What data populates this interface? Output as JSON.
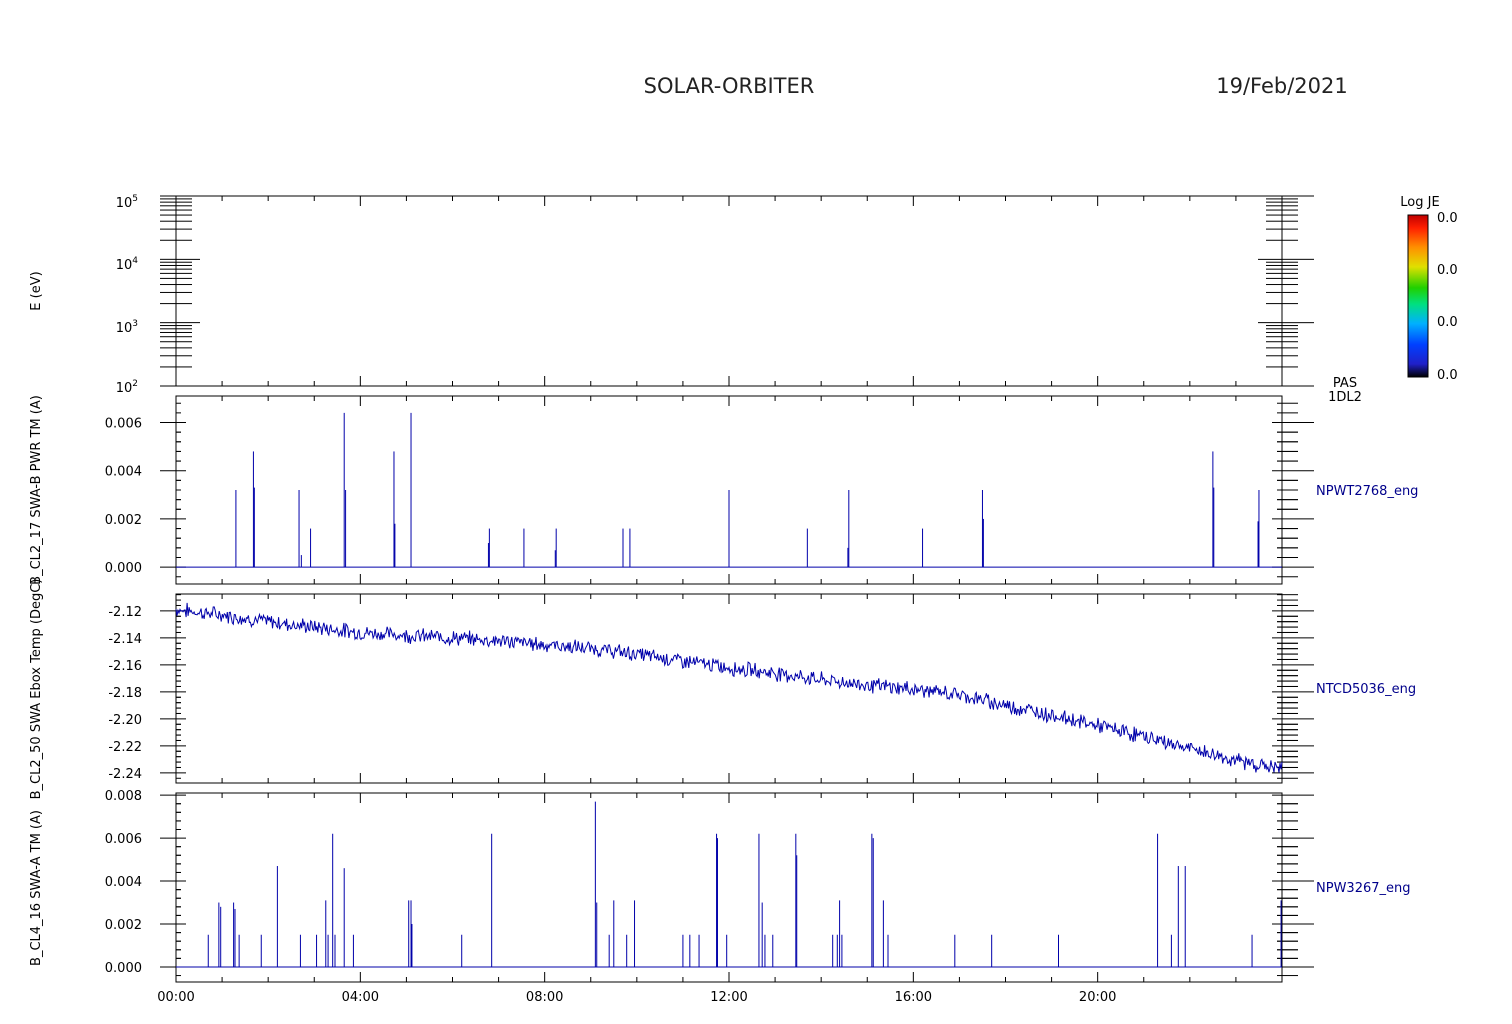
{
  "header": {
    "title": "SOLAR-ORBITER",
    "date": "19/Feb/2021"
  },
  "colorbar": {
    "title": "Log JE",
    "ticks": [
      "0.0",
      "0.0",
      "0.0",
      "0.0"
    ]
  },
  "colors": {
    "axes": "#000000",
    "series": "#0000aa",
    "series_label": "#00008b"
  },
  "chart_data": [
    {
      "type": "heatmap",
      "ylabel": "E (eV)",
      "yscale": "log",
      "ylim": [
        100,
        100000
      ],
      "yticks": [
        {
          "base": "10",
          "exp": "2",
          "value": 100
        },
        {
          "base": "10",
          "exp": "3",
          "value": 1000
        },
        {
          "base": "10",
          "exp": "4",
          "value": 10000
        },
        {
          "base": "10",
          "exp": "5",
          "value": 100000
        }
      ],
      "side_label": [
        "PAS",
        "1DL2"
      ]
    },
    {
      "type": "line",
      "ylabel": "B_CL2_17 SWA-B PWR TM (A)",
      "ylim": [
        -0.0007,
        0.0071
      ],
      "yticks": [
        "0.000",
        "0.002",
        "0.004",
        "0.006"
      ],
      "series_name": "NPWT2768_eng",
      "spikes": [
        [
          1.3,
          0.0032
        ],
        [
          1.68,
          0.0048
        ],
        [
          1.7,
          0.0033
        ],
        [
          2.67,
          0.0032
        ],
        [
          2.72,
          0.0005
        ],
        [
          2.92,
          0.0016
        ],
        [
          3.65,
          0.0064
        ],
        [
          3.68,
          0.0032
        ],
        [
          4.73,
          0.0048
        ],
        [
          4.75,
          0.0018
        ],
        [
          5.1,
          0.0064
        ],
        [
          6.8,
          0.0016
        ],
        [
          6.78,
          0.001
        ],
        [
          7.55,
          0.0016
        ],
        [
          8.25,
          0.0016
        ],
        [
          8.23,
          0.0007
        ],
        [
          9.7,
          0.0016
        ],
        [
          9.85,
          0.0016
        ],
        [
          12.0,
          0.0032
        ],
        [
          13.7,
          0.0016
        ],
        [
          14.6,
          0.0032
        ],
        [
          14.58,
          0.0008
        ],
        [
          16.2,
          0.0016
        ],
        [
          17.5,
          0.0032
        ],
        [
          17.52,
          0.002
        ],
        [
          22.5,
          0.0048
        ],
        [
          22.52,
          0.0033
        ],
        [
          23.5,
          0.0032
        ],
        [
          23.48,
          0.0019
        ]
      ]
    },
    {
      "type": "line",
      "ylabel": "B_CL2_50 SWA Ebox Temp (DegC)",
      "ylim": [
        -2.2475,
        -2.1075
      ],
      "yticks": [
        "-2.12",
        "-2.14",
        "-2.16",
        "-2.18",
        "-2.20",
        "-2.22",
        "-2.24"
      ],
      "series_name": "NTCD5036_eng",
      "trend": [
        [
          0,
          -2.119
        ],
        [
          1,
          -2.123
        ],
        [
          2,
          -2.128
        ],
        [
          3,
          -2.132
        ],
        [
          4,
          -2.136
        ],
        [
          5,
          -2.138
        ],
        [
          6,
          -2.14
        ],
        [
          7,
          -2.142
        ],
        [
          8,
          -2.145
        ],
        [
          9,
          -2.148
        ],
        [
          10,
          -2.152
        ],
        [
          11,
          -2.157
        ],
        [
          12,
          -2.162
        ],
        [
          13,
          -2.166
        ],
        [
          14,
          -2.171
        ],
        [
          15,
          -2.175
        ],
        [
          16,
          -2.178
        ],
        [
          17,
          -2.182
        ],
        [
          18,
          -2.19
        ],
        [
          19,
          -2.197
        ],
        [
          20,
          -2.205
        ],
        [
          21,
          -2.213
        ],
        [
          22,
          -2.222
        ],
        [
          23,
          -2.231
        ],
        [
          24,
          -2.237
        ]
      ]
    },
    {
      "type": "line",
      "ylabel": "B_CL4_16 SWA-A TM (A)",
      "ylim": [
        -0.0007,
        0.0081
      ],
      "yticks": [
        "0.000",
        "0.002",
        "0.004",
        "0.006",
        "0.008"
      ],
      "series_name": "NPW3267_eng",
      "xlabels": [
        "00:00",
        "04:00",
        "08:00",
        "12:00",
        "16:00",
        "20:00"
      ],
      "xlim": [
        0,
        24
      ],
      "spikes": [
        [
          0.7,
          0.0015
        ],
        [
          0.93,
          0.003
        ],
        [
          0.97,
          0.0028
        ],
        [
          1.25,
          0.003
        ],
        [
          1.28,
          0.0027
        ],
        [
          1.37,
          0.0015
        ],
        [
          1.85,
          0.0015
        ],
        [
          2.2,
          0.0047
        ],
        [
          2.7,
          0.0015
        ],
        [
          3.05,
          0.0015
        ],
        [
          3.25,
          0.0031
        ],
        [
          3.3,
          0.0015
        ],
        [
          3.4,
          0.0062
        ],
        [
          3.45,
          0.0015
        ],
        [
          3.65,
          0.0046
        ],
        [
          3.85,
          0.0015
        ],
        [
          5.05,
          0.0031
        ],
        [
          5.1,
          0.0031
        ],
        [
          5.12,
          0.002
        ],
        [
          6.2,
          0.0015
        ],
        [
          6.85,
          0.0062
        ],
        [
          9.1,
          0.0077
        ],
        [
          9.13,
          0.003
        ],
        [
          9.4,
          0.0015
        ],
        [
          9.5,
          0.0031
        ],
        [
          9.78,
          0.0015
        ],
        [
          9.95,
          0.0031
        ],
        [
          11.0,
          0.0015
        ],
        [
          11.15,
          0.0015
        ],
        [
          11.35,
          0.0015
        ],
        [
          11.73,
          0.0062
        ],
        [
          11.75,
          0.006
        ],
        [
          11.95,
          0.0015
        ],
        [
          12.65,
          0.0062
        ],
        [
          12.72,
          0.003
        ],
        [
          12.78,
          0.0015
        ],
        [
          12.95,
          0.0015
        ],
        [
          13.45,
          0.0062
        ],
        [
          13.47,
          0.0052
        ],
        [
          14.25,
          0.0015
        ],
        [
          14.35,
          0.0015
        ],
        [
          14.4,
          0.0031
        ],
        [
          14.45,
          0.0015
        ],
        [
          15.1,
          0.0062
        ],
        [
          15.13,
          0.006
        ],
        [
          15.35,
          0.0031
        ],
        [
          15.45,
          0.0015
        ],
        [
          16.9,
          0.0015
        ],
        [
          17.7,
          0.0015
        ],
        [
          19.15,
          0.0015
        ],
        [
          21.3,
          0.0062
        ],
        [
          21.6,
          0.0015
        ],
        [
          21.75,
          0.0047
        ],
        [
          21.9,
          0.0047
        ],
        [
          23.35,
          0.0015
        ],
        [
          23.98,
          0.0031
        ]
      ]
    }
  ]
}
